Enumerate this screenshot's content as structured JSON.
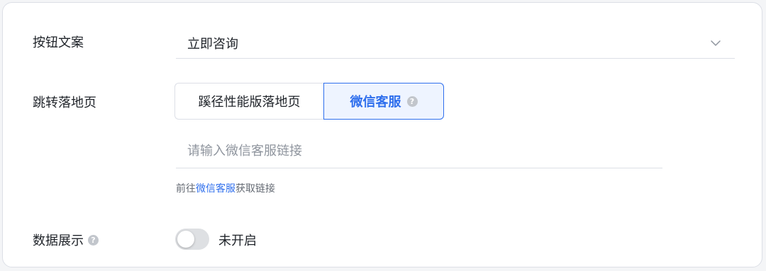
{
  "form": {
    "button_text": {
      "label": "按钮文案",
      "value": "立即咨询"
    },
    "landing_page": {
      "label": "跳转落地页",
      "options": [
        "蹊径性能版落地页",
        "微信客服"
      ],
      "selected": "微信客服",
      "help": "?",
      "input_placeholder": "请输入微信客服链接",
      "hint_prefix": "前往",
      "hint_link": "微信客服",
      "hint_suffix": "获取链接"
    },
    "data_display": {
      "label": "数据展示",
      "help": "?",
      "status": "未开启",
      "enabled": false
    }
  },
  "colors": {
    "accent": "#2f6fed",
    "accent_bg": "#eef4ff",
    "border": "#dcdfe6",
    "switch_off": "#dee0e3"
  }
}
